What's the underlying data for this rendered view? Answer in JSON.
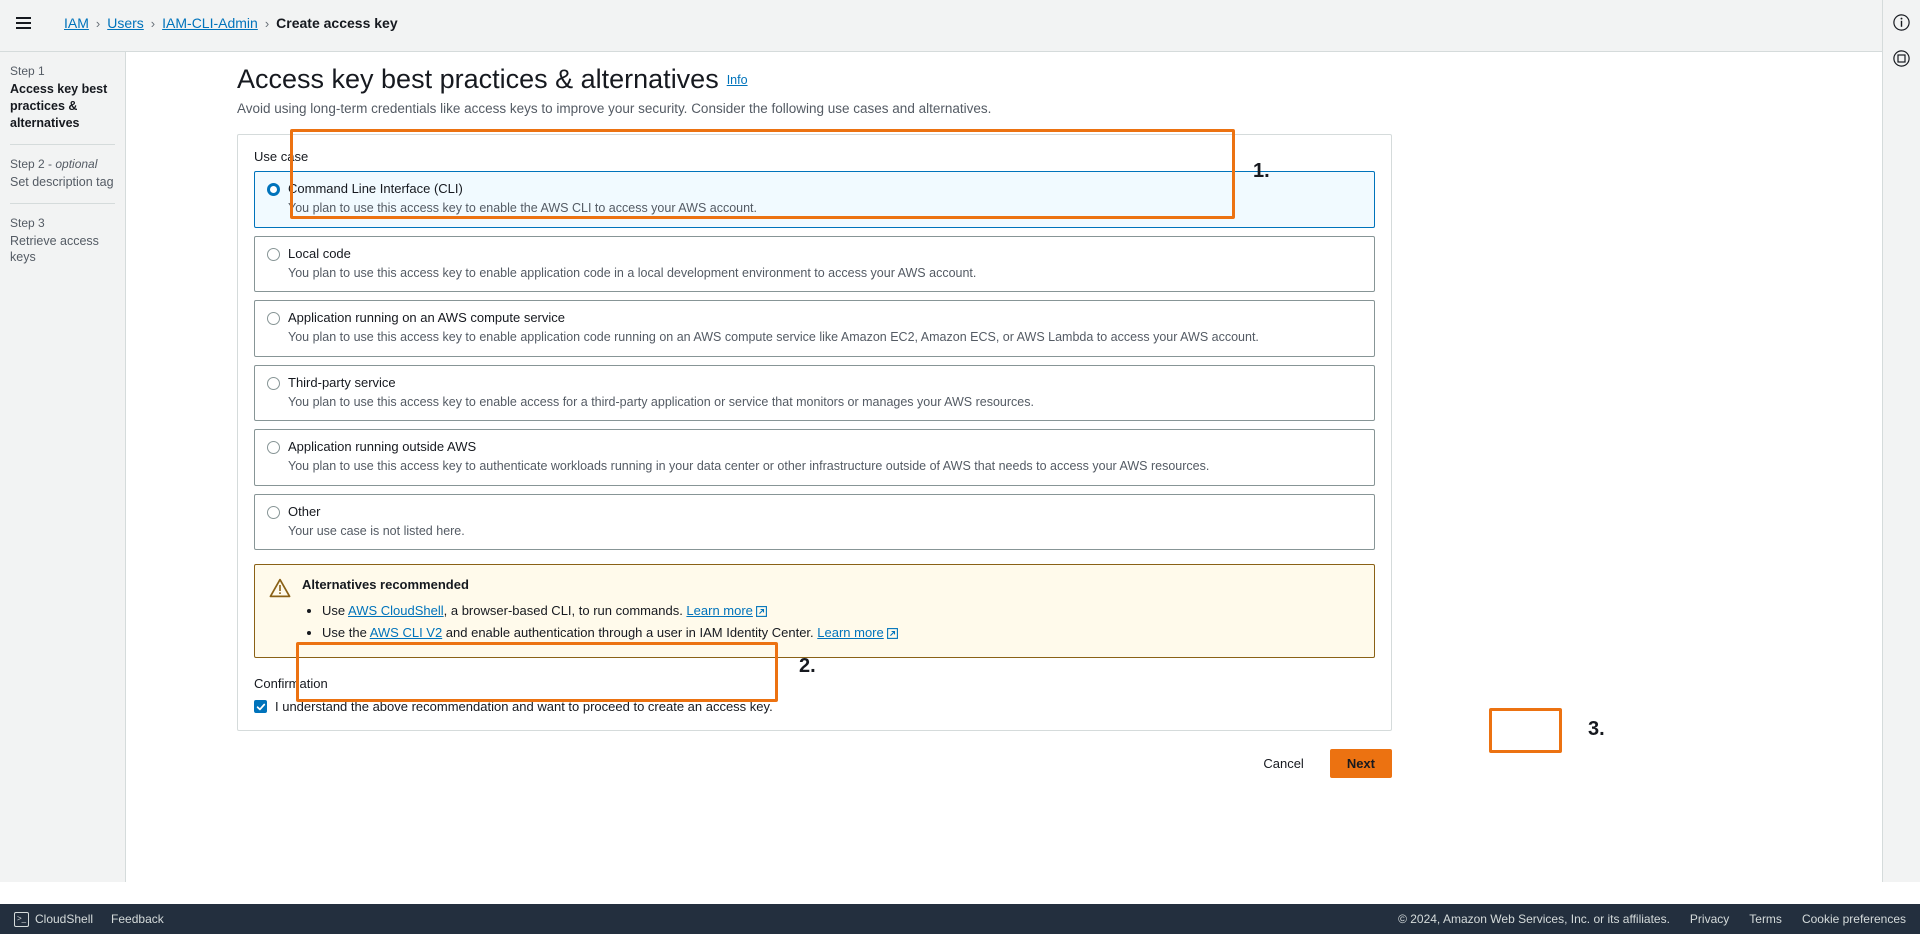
{
  "topbar": {
    "menu_icon": "hamburger-menu-icon",
    "rail_icons": [
      "info-circle-icon",
      "shortcut-circle-icon"
    ]
  },
  "breadcrumb": {
    "items": [
      {
        "label": "IAM",
        "link": true
      },
      {
        "label": "Users",
        "link": true
      },
      {
        "label": "IAM-CLI-Admin",
        "link": true
      },
      {
        "label": "Create access key",
        "link": false
      }
    ],
    "separator": "›"
  },
  "sidebar": {
    "steps": [
      {
        "num": "Step 1",
        "optional": "",
        "title": "Access key best practices & alternatives",
        "active": true
      },
      {
        "num": "Step 2 - ",
        "optional": "optional",
        "title": "Set description tag",
        "active": false
      },
      {
        "num": "Step 3",
        "optional": "",
        "title": "Retrieve access keys",
        "active": false
      }
    ]
  },
  "page": {
    "title": "Access key best practices & alternatives",
    "info_label": "Info",
    "subtitle": "Avoid using long-term credentials like access keys to improve your security. Consider the following use cases and alternatives."
  },
  "form": {
    "use_case_label": "Use case",
    "options": [
      {
        "label": "Command Line Interface (CLI)",
        "desc": "You plan to use this access key to enable the AWS CLI to access your AWS account.",
        "selected": true
      },
      {
        "label": "Local code",
        "desc": "You plan to use this access key to enable application code in a local development environment to access your AWS account.",
        "selected": false
      },
      {
        "label": "Application running on an AWS compute service",
        "desc": "You plan to use this access key to enable application code running on an AWS compute service like Amazon EC2, Amazon ECS, or AWS Lambda to access your AWS account.",
        "selected": false
      },
      {
        "label": "Third-party service",
        "desc": "You plan to use this access key to enable access for a third-party application or service that monitors or manages your AWS resources.",
        "selected": false
      },
      {
        "label": "Application running outside AWS",
        "desc": "You plan to use this access key to authenticate workloads running in your data center or other infrastructure outside of AWS that needs to access your AWS resources.",
        "selected": false
      },
      {
        "label": "Other",
        "desc": "Your use case is not listed here.",
        "selected": false
      }
    ]
  },
  "alert": {
    "icon": "warning-triangle-icon",
    "title": "Alternatives recommended",
    "bullets": [
      {
        "prefix": "Use ",
        "link": "AWS CloudShell",
        "middle": ", a browser-based CLI, to run commands. ",
        "learn_more": "Learn more",
        "external_icon": "external-link-icon"
      },
      {
        "prefix": "Use the ",
        "link": "AWS CLI V2",
        "middle": " and enable authentication through a user in IAM Identity Center. ",
        "learn_more": "Learn more",
        "external_icon": "external-link-icon"
      }
    ]
  },
  "confirmation": {
    "label": "Confirmation",
    "checkbox_checked": true,
    "check_icon": "checkmark-icon",
    "text": "I understand the above recommendation and want to proceed to create an access key."
  },
  "actions": {
    "cancel_label": "Cancel",
    "next_label": "Next"
  },
  "annotations": [
    {
      "number": "1."
    },
    {
      "number": "2."
    },
    {
      "number": "3."
    }
  ],
  "footer": {
    "cloudshell_label": "CloudShell",
    "cloudshell_icon": "cloudshell-icon",
    "feedback_label": "Feedback",
    "copyright": "© 2024, Amazon Web Services, Inc. or its affiliates.",
    "links": [
      "Privacy",
      "Terms",
      "Cookie preferences"
    ]
  },
  "colors": {
    "accent_orange": "#ec7211",
    "link_blue": "#0073bb",
    "alert_border": "#8a6116",
    "alert_bg": "#fffaeb",
    "footer_bg": "#232f3e"
  }
}
